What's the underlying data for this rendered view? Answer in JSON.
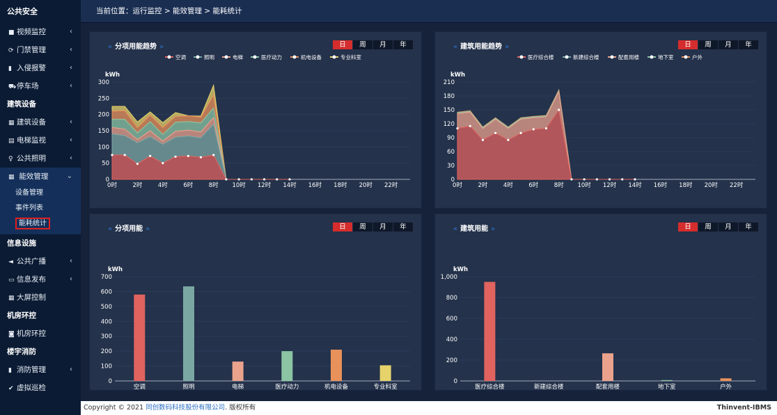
{
  "sidebar": {
    "top_title": "公共安全",
    "items_a": [
      {
        "icon": "■",
        "label": "视频监控"
      },
      {
        "icon": "⟳",
        "label": "门禁管理"
      },
      {
        "icon": "▮",
        "label": "入侵报警"
      },
      {
        "icon": "⛟",
        "label": "停车场"
      }
    ],
    "section_building": "建筑设备",
    "items_b": [
      {
        "icon": "▦",
        "label": "建筑设备"
      },
      {
        "icon": "▤",
        "label": "电梯监视"
      },
      {
        "icon": "♀",
        "label": "公共照明"
      }
    ],
    "energy_item": {
      "icon": "▦",
      "label": "能效管理"
    },
    "energy_subs": [
      "设备管理",
      "事件列表"
    ],
    "energy_current": "能耗统计",
    "section_info": "信息设施",
    "items_c": [
      {
        "icon": "◄",
        "label": "公共广播",
        "chev": true
      },
      {
        "icon": "▭",
        "label": "信息发布",
        "chev": true
      },
      {
        "icon": "▦",
        "label": "大屏控制",
        "chev": false
      }
    ],
    "section_room": "机房环控",
    "items_d": [
      {
        "icon": "◙",
        "label": "机房环控",
        "chev": false
      }
    ],
    "section_fire": "楼宇消防",
    "items_e": [
      {
        "icon": "▮",
        "label": "消防管理",
        "chev": true
      },
      {
        "icon": "✔",
        "label": "虚拟巡检",
        "chev": false
      }
    ]
  },
  "breadcrumb": "当前位置：运行监控 > 能效管理 > 能耗统计",
  "tabs": [
    "日",
    "周",
    "月",
    "年"
  ],
  "panels": {
    "trend_category_title": "分项用能趋势",
    "trend_building_title": "建筑用能趋势",
    "bar_category_title": "分项用能",
    "bar_building_title": "建筑用能"
  },
  "colors": {
    "series": [
      "#e0635f",
      "#7ba7a3",
      "#eaa28c",
      "#8cc5a4",
      "#e9915a",
      "#e6d26a"
    ],
    "tab_active": "#d52d2d",
    "accent": "#2e74d1"
  },
  "chart_data": [
    {
      "type": "area",
      "title": "分项用能趋势",
      "ylabel": "kWh",
      "ylim": [
        0,
        300
      ],
      "yticks": [
        0,
        50,
        100,
        150,
        200,
        250,
        300
      ],
      "x_tick_labels": [
        "0时",
        "2时",
        "4时",
        "6时",
        "8时",
        "10时",
        "12时",
        "14时",
        "16时",
        "18时",
        "20时",
        "22时"
      ],
      "x": [
        0,
        1,
        2,
        3,
        4,
        5,
        6,
        7,
        8,
        9,
        10,
        11,
        12,
        13,
        14
      ],
      "series": [
        {
          "name": "空调",
          "values": [
            75,
            75,
            48,
            72,
            50,
            70,
            72,
            68,
            75,
            0,
            0,
            0,
            0,
            0,
            0
          ]
        },
        {
          "name": "照明",
          "values": [
            65,
            60,
            65,
            60,
            58,
            60,
            62,
            60,
            95,
            0,
            0,
            0,
            0,
            0,
            0
          ]
        },
        {
          "name": "电梯",
          "values": [
            20,
            20,
            10,
            18,
            10,
            18,
            18,
            18,
            20,
            0,
            0,
            0,
            0,
            0,
            0
          ]
        },
        {
          "name": "医疗动力",
          "values": [
            25,
            30,
            20,
            28,
            20,
            28,
            26,
            28,
            30,
            0,
            0,
            0,
            0,
            0,
            0
          ]
        },
        {
          "name": "机电设备",
          "values": [
            25,
            27,
            17,
            20,
            22,
            18,
            18,
            18,
            40,
            0,
            0,
            0,
            0,
            0,
            0
          ]
        },
        {
          "name": "专业科室",
          "values": [
            15,
            13,
            17,
            10,
            15,
            12,
            0,
            3,
            30,
            0,
            0,
            0,
            0,
            0,
            0
          ]
        }
      ]
    },
    {
      "type": "area",
      "title": "建筑用能趋势",
      "ylabel": "kWh",
      "ylim": [
        0,
        210
      ],
      "yticks": [
        0,
        30,
        60,
        90,
        120,
        150,
        180,
        210
      ],
      "x_tick_labels": [
        "0时",
        "2时",
        "4时",
        "6时",
        "8时",
        "10时",
        "12时",
        "14时",
        "16时",
        "18时",
        "20时",
        "22时"
      ],
      "x": [
        0,
        1,
        2,
        3,
        4,
        5,
        6,
        7,
        8,
        9,
        10,
        11,
        12,
        13,
        14
      ],
      "series": [
        {
          "name": "医疗综合楼",
          "values": [
            110,
            115,
            85,
            100,
            85,
            100,
            108,
            110,
            150,
            0,
            0,
            0,
            0,
            0,
            0
          ]
        },
        {
          "name": "新建综合楼",
          "values": [
            0,
            0,
            0,
            0,
            0,
            0,
            0,
            0,
            0,
            0,
            0,
            0,
            0,
            0,
            0
          ]
        },
        {
          "name": "配套用楼",
          "values": [
            32,
            30,
            25,
            30,
            25,
            30,
            25,
            25,
            40,
            0,
            0,
            0,
            0,
            0,
            0
          ]
        },
        {
          "name": "地下室",
          "values": [
            2,
            2,
            2,
            2,
            2,
            2,
            2,
            2,
            2,
            0,
            0,
            0,
            0,
            0,
            0
          ]
        },
        {
          "name": "户外",
          "values": [
            1,
            1,
            1,
            1,
            1,
            1,
            1,
            1,
            1,
            0,
            0,
            0,
            0,
            0,
            0
          ]
        }
      ]
    },
    {
      "type": "bar",
      "title": "分项用能",
      "ylabel": "kWh",
      "ylim": [
        0,
        700
      ],
      "yticks": [
        0,
        100,
        200,
        300,
        400,
        500,
        600,
        700
      ],
      "categories": [
        "空调",
        "照明",
        "电梯",
        "医疗动力",
        "机电设备",
        "专业科室"
      ],
      "values": [
        580,
        635,
        130,
        200,
        210,
        105
      ]
    },
    {
      "type": "bar",
      "title": "建筑用能",
      "ylabel": "kWh",
      "ylim": [
        0,
        1000
      ],
      "yticks": [
        0,
        200,
        400,
        600,
        800,
        "1,000"
      ],
      "categories": [
        "医疗综合楼",
        "新建综合楼",
        "配套用楼",
        "地下室",
        "户外"
      ],
      "values": [
        950,
        0,
        265,
        8,
        25
      ]
    }
  ],
  "footer": {
    "prefix": "Copyright © 2021",
    "company": "同创数码科技股份有限公司",
    "suffix": ". 版权所有",
    "brand": "Thinvent-IBMS"
  }
}
